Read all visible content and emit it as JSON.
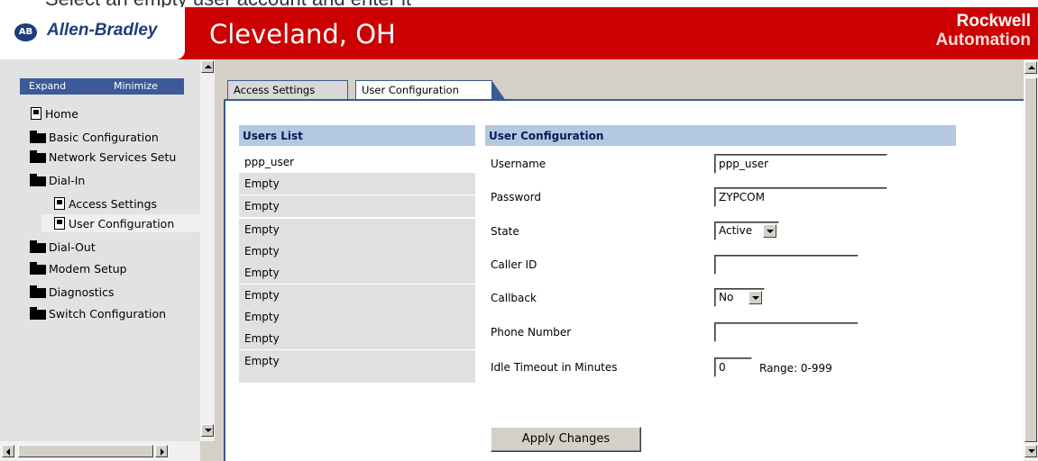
{
  "top_strip": "Select an empty user account and enter it",
  "header": {
    "brand_badge": "AB",
    "brand": "Allen-Bradley",
    "site_title": "Cleveland, OH",
    "logo_line1": "Rockwell",
    "logo_line2": "Automation",
    "color": "#cc0000"
  },
  "sidebar": {
    "expand_label": "Expand",
    "minimize_label": "Minimize",
    "items": [
      {
        "label": "Home",
        "icon": "document-icon"
      },
      {
        "label": "Basic Configuration",
        "icon": "folder-icon"
      },
      {
        "label": "Network Services Setu",
        "icon": "folder-icon"
      },
      {
        "label": "Dial-In",
        "icon": "open-folder-icon"
      },
      {
        "label": "Access Settings",
        "icon": "document-icon"
      },
      {
        "label": "User Configuration",
        "icon": "document-icon",
        "selected": true
      },
      {
        "label": "Dial-Out",
        "icon": "folder-icon"
      },
      {
        "label": "Modem Setup",
        "icon": "folder-icon"
      },
      {
        "label": "Diagnostics",
        "icon": "folder-icon"
      },
      {
        "label": "Switch Configuration",
        "icon": "folder-icon"
      }
    ]
  },
  "tabs": [
    {
      "label": "Access Settings"
    },
    {
      "label": "User Configuration",
      "active": true
    }
  ],
  "users_list": {
    "header": "Users List",
    "users": [
      "ppp_user",
      "Empty",
      "Empty",
      "Empty",
      "Empty",
      "Empty",
      "Empty",
      "Empty",
      "Empty",
      "Empty"
    ]
  },
  "user_config": {
    "header": "User Configuration",
    "username_label": "Username",
    "username_value": "ppp_user",
    "password_label": "Password",
    "password_value": "ZYPCOM",
    "state_label": "State",
    "state_value": "Active",
    "caller_id_label": "Caller ID",
    "caller_id_value": "",
    "callback_label": "Callback",
    "callback_value": "No",
    "phone_label": "Phone Number",
    "phone_value": "",
    "idle_label": "Idle Timeout in Minutes",
    "idle_value": "0",
    "range_text": "Range: 0-999",
    "apply_label": "Apply Changes"
  }
}
